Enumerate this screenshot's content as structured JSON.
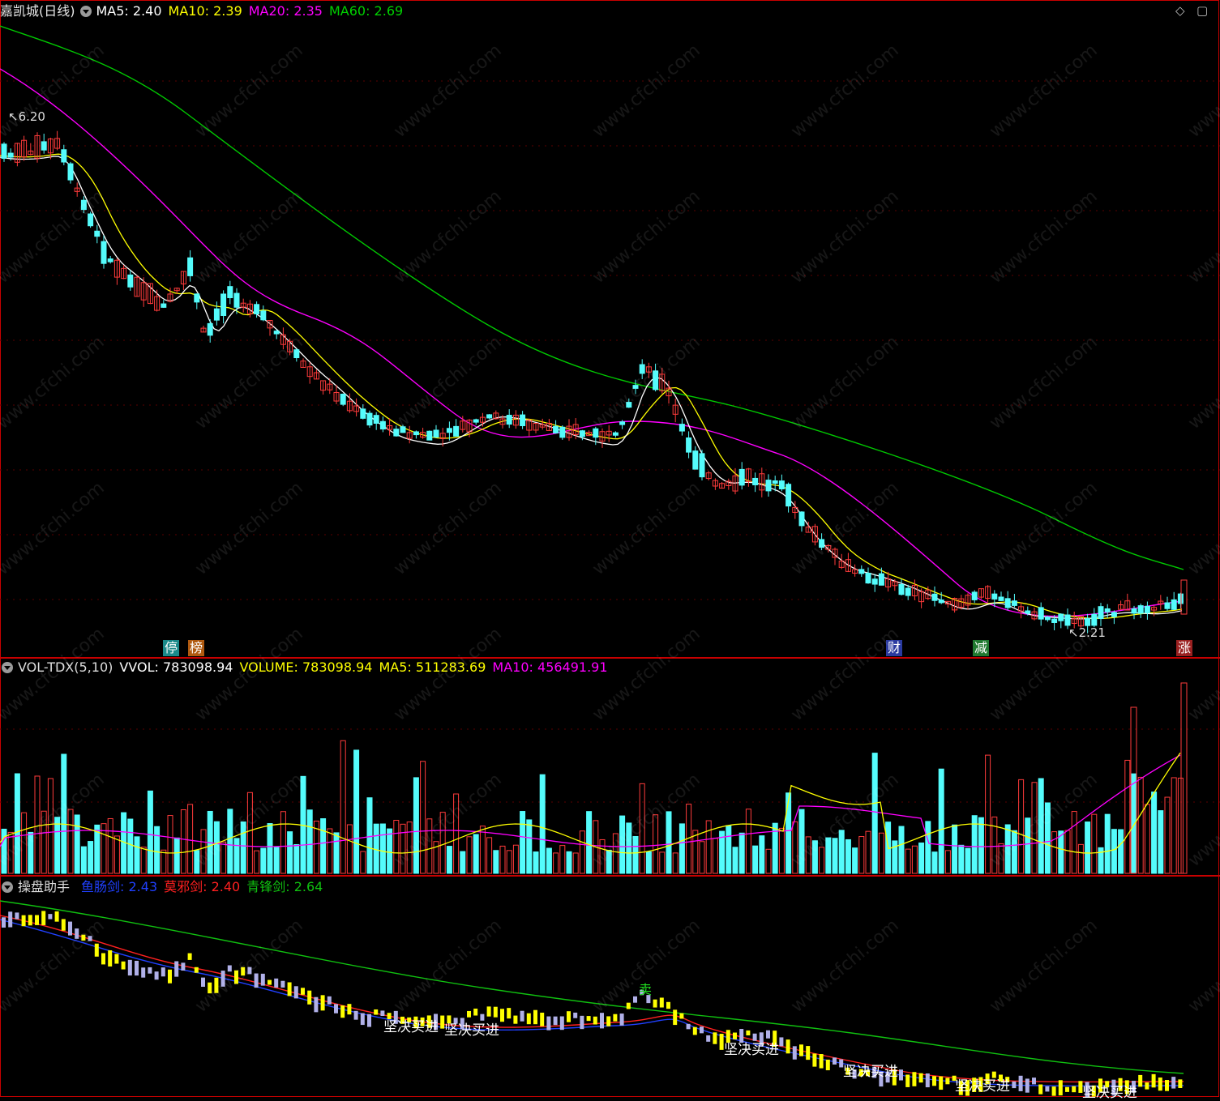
{
  "main": {
    "title": "嘉凯城(日线)",
    "ma5": "MA5: 2.40",
    "ma10": "MA10: 2.39",
    "ma20": "MA20: 2.35",
    "ma60": "MA60: 2.69",
    "high_label": "6.20",
    "low_label": "2.21",
    "markers": [
      "停",
      "榜",
      "财",
      "减",
      "涨"
    ]
  },
  "volume": {
    "name": "VOL-TDX(5,10)",
    "vvol": "VVOL: 783098.94",
    "volume": "VOLUME: 783098.94",
    "ma5": "MA5: 511283.69",
    "ma10": "MA10: 456491.91"
  },
  "indicator": {
    "name": "操盘助手",
    "l1": "鱼肠剑: 2.43",
    "l2": "莫邪剑: 2.40",
    "l3": "青锋剑: 2.64",
    "sell": "卖",
    "buy": "坚决买进"
  },
  "watermark": "www.cfchi.com",
  "colors": {
    "bg": "#000000",
    "up": "#ff3b3b",
    "down": "#54fcfc",
    "ma5": "#ffffff",
    "ma10": "#ffff00",
    "ma20": "#ff00ff",
    "ma60": "#00c800",
    "frame": "#c80000"
  }
}
